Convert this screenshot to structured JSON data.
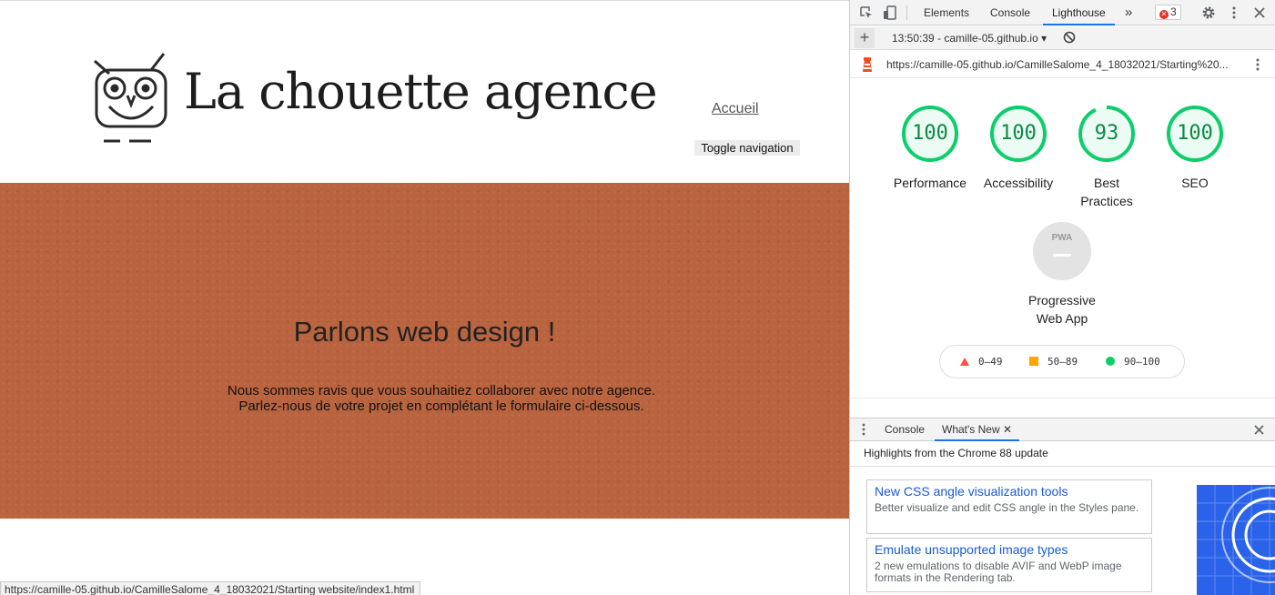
{
  "site": {
    "logo_text": "La chouette agence",
    "nav_link": "Accueil",
    "toggle_nav": "Toggle navigation",
    "hero_title": "Parlons web design !",
    "hero_line1": "Nous sommes ravis que vous souhaitiez collaborer avec notre agence.",
    "hero_line2": "Parlez-nous de votre projet en complétant le formulaire ci-dessous.",
    "status_url": "https://camille-05.github.io/CamilleSalome_4_18032021/Starting website/index1.html",
    "hero_color": "#b9633f"
  },
  "devtools": {
    "tabs": [
      "Elements",
      "Console",
      "Lighthouse"
    ],
    "active_tab": "Lighthouse",
    "error_count": "3",
    "report_name": "13:50:39 - camille-05.github.io",
    "report_url": "https://camille-05.github.io/CamilleSalome_4_18032021/Starting%20...",
    "scores": [
      {
        "label": "Performance",
        "score": 100
      },
      {
        "label": "Accessibility",
        "score": 100
      },
      {
        "label": "Best Practices",
        "score": 93
      },
      {
        "label": "SEO",
        "score": 100
      }
    ],
    "pwa": {
      "badge": "PWA",
      "label_line1": "Progressive",
      "label_line2": "Web App"
    },
    "legend": {
      "fail": "0–49",
      "average": "50–89",
      "pass": "90–100"
    },
    "colors": {
      "pass": "#0cce6b",
      "average": "#ffa400",
      "fail": "#ff4e42",
      "accent": "#1a73e8"
    },
    "drawer": {
      "tabs": [
        "Console",
        "What's New"
      ],
      "active_tab": "What's New",
      "highlights": "Highlights from the Chrome 88 update",
      "cards": [
        {
          "title": "New CSS angle visualization tools",
          "desc": "Better visualize and edit CSS angle in the Styles pane."
        },
        {
          "title": "Emulate unsupported image types",
          "desc": "2 new emulations to disable AVIF and WebP image formats in the Rendering tab."
        }
      ]
    }
  }
}
